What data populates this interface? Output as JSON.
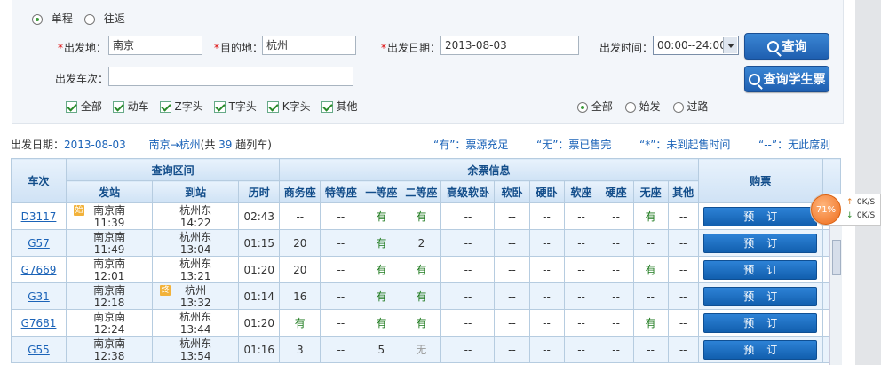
{
  "trip_type": {
    "one_way": "单程",
    "round_trip": "往返"
  },
  "form": {
    "from_label": "出发地：",
    "from_value": "南京",
    "to_label": "目的地：",
    "to_value": "杭州",
    "date_label": "出发日期：",
    "date_value": "2013-08-03",
    "time_label": "出发时间：",
    "time_value": "00:00--24:00",
    "train_no_label": "出发车次：",
    "train_no_value": "",
    "query_button": "查询",
    "student_button": "查询学生票",
    "required_mark": "*"
  },
  "train_types": [
    "全部",
    "动车",
    "Z字头",
    "T字头",
    "K字头",
    "其他"
  ],
  "station_filter": [
    "全部",
    "始发",
    "过路"
  ],
  "summary": {
    "date_label": "出发日期：",
    "date_value": "2013-08-03",
    "route": "南京→杭州",
    "count_prefix": "(共",
    "count": "39",
    "count_suffix": "趟列车)"
  },
  "legend": {
    "yes": "“有”：票源充足",
    "none": "“无”：票已售完",
    "star": "“*”：未到起售时间",
    "dash": "“--”：无此席别"
  },
  "table": {
    "headers": {
      "train": "车次",
      "section": "查询区间",
      "seats": "余票信息",
      "book": "购票",
      "depart": "发站",
      "arrive": "到站",
      "duration": "历时",
      "seat_types": [
        "商务座",
        "特等座",
        "一等座",
        "二等座",
        "高级软卧",
        "软卧",
        "硬卧",
        "软座",
        "硬座",
        "无座",
        "其他"
      ]
    },
    "book_label": "预订",
    "rows": [
      {
        "train": "D3117",
        "tag": "始",
        "from": "南京南",
        "dep": "11:39",
        "to_tag": "",
        "to": "杭州东",
        "arr": "14:22",
        "dur": "02:43",
        "seats": [
          "--",
          "--",
          "有",
          "有",
          "--",
          "--",
          "--",
          "--",
          "--",
          "有",
          "--"
        ]
      },
      {
        "train": "G57",
        "tag": "",
        "from": "南京南",
        "dep": "11:49",
        "to_tag": "",
        "to": "杭州东",
        "arr": "13:04",
        "dur": "01:15",
        "seats": [
          "20",
          "--",
          "有",
          "2",
          "--",
          "--",
          "--",
          "--",
          "--",
          "--",
          "--"
        ]
      },
      {
        "train": "G7669",
        "tag": "",
        "from": "南京南",
        "dep": "12:01",
        "to_tag": "",
        "to": "杭州东",
        "arr": "13:21",
        "dur": "01:20",
        "seats": [
          "20",
          "--",
          "有",
          "有",
          "--",
          "--",
          "--",
          "--",
          "--",
          "有",
          "--"
        ]
      },
      {
        "train": "G31",
        "tag": "",
        "from": "南京南",
        "dep": "12:18",
        "to_tag": "终",
        "to": "杭州",
        "arr": "13:32",
        "dur": "01:14",
        "seats": [
          "16",
          "--",
          "有",
          "有",
          "--",
          "--",
          "--",
          "--",
          "--",
          "--",
          "--"
        ]
      },
      {
        "train": "G7681",
        "tag": "",
        "from": "南京南",
        "dep": "12:24",
        "to_tag": "",
        "to": "杭州东",
        "arr": "13:44",
        "dur": "01:20",
        "seats": [
          "有",
          "--",
          "有",
          "有",
          "--",
          "--",
          "--",
          "--",
          "--",
          "有",
          "--"
        ]
      },
      {
        "train": "G55",
        "tag": "",
        "from": "南京南",
        "dep": "12:38",
        "to_tag": "",
        "to": "杭州东",
        "arr": "13:54",
        "dur": "01:16",
        "seats": [
          "3",
          "--",
          "5",
          "无",
          "--",
          "--",
          "--",
          "--",
          "--",
          "--",
          "--"
        ]
      }
    ]
  },
  "speed_widget": {
    "percent": "71%",
    "up": "0K/S",
    "down": "0K/S"
  },
  "colors": {
    "accent": "#1b63b8",
    "header_text": "#124d8a",
    "available": "#1d7a1d",
    "button": "#1f5fb0"
  }
}
